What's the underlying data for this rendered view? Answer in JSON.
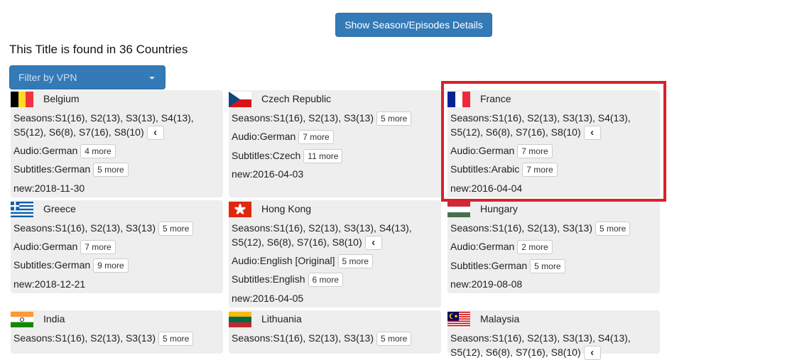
{
  "top_button": "Show Season/Episodes Details",
  "heading": "This Title is found in 36 Countries",
  "vpn_filter": "Filter by VPN",
  "colors": {
    "primary": "#337ab7",
    "card_bg": "#eeeeee",
    "highlight": "#d9212a"
  },
  "cards": [
    {
      "country": "Belgium",
      "seasons": "Seasons:S1(16), S2(13), S3(13), S4(13),",
      "seasons2": "S5(12), S6(8), S7(16), S8(10)",
      "audio": "Audio:German",
      "audio_more": "4 more",
      "subtitles": "Subtitles:German",
      "subtitles_more": "5 more",
      "new": "new:2018-11-30"
    },
    {
      "country": "Czech Republic",
      "seasons": "Seasons:S1(16), S2(13), S3(13)",
      "seasons_more": "5 more",
      "audio": "Audio:German",
      "audio_more": "7 more",
      "subtitles": "Subtitles:Czech",
      "subtitles_more": "11 more",
      "new": "new:2016-04-03"
    },
    {
      "country": "France",
      "seasons": "Seasons:S1(16), S2(13), S3(13), S4(13),",
      "seasons2": "S5(12), S6(8), S7(16), S8(10)",
      "audio": "Audio:German",
      "audio_more": "7 more",
      "subtitles": "Subtitles:Arabic",
      "subtitles_more": "7 more",
      "new": "new:2016-04-04"
    },
    {
      "country": "Greece",
      "seasons": "Seasons:S1(16), S2(13), S3(13)",
      "seasons_more": "5 more",
      "audio": "Audio:German",
      "audio_more": "7 more",
      "subtitles": "Subtitles:German",
      "subtitles_more": "9 more",
      "new": "new:2018-12-21"
    },
    {
      "country": "Hong Kong",
      "seasons": "Seasons:S1(16), S2(13), S3(13), S4(13),",
      "seasons2": "S5(12), S6(8), S7(16), S8(10)",
      "audio": "Audio:English [Original]",
      "audio_more": "5 more",
      "subtitles": "Subtitles:English",
      "subtitles_more": "6 more",
      "new": "new:2016-04-05"
    },
    {
      "country": "Hungary",
      "seasons": "Seasons:S1(16), S2(13), S3(13)",
      "seasons_more": "5 more",
      "audio": "Audio:German",
      "audio_more": "2 more",
      "subtitles": "Subtitles:German",
      "subtitles_more": "5 more",
      "new": "new:2019-08-08"
    },
    {
      "country": "India",
      "seasons": "Seasons:S1(16), S2(13), S3(13)",
      "seasons_more": "5 more"
    },
    {
      "country": "Lithuania",
      "seasons": "Seasons:S1(16), S2(13), S3(13)",
      "seasons_more": "5 more"
    },
    {
      "country": "Malaysia",
      "seasons": "Seasons:S1(16), S2(13), S3(13), S4(13),",
      "seasons2": "S5(12), S6(8), S7(16), S8(10)"
    }
  ]
}
